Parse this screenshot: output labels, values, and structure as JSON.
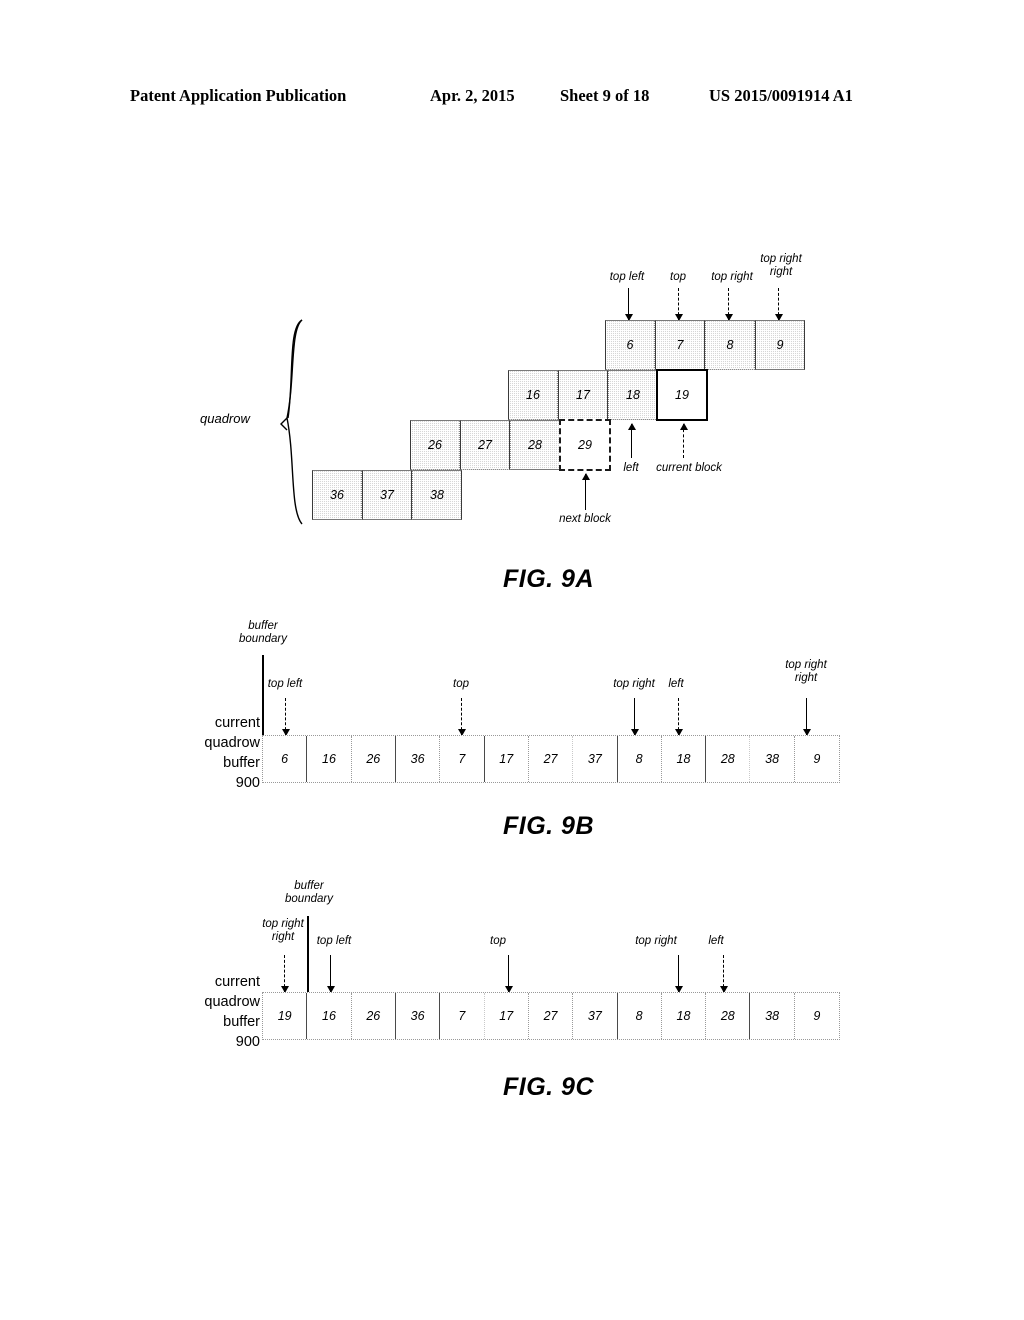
{
  "header": {
    "title": "Patent Application Publication",
    "date": "Apr. 2, 2015",
    "sheet": "Sheet 9 of 18",
    "patent_number": "US 2015/0091914 A1"
  },
  "figures": [
    {
      "id": "9A",
      "caption": "FIG. 9A",
      "group_label": "quadrow",
      "blocks": [
        {
          "id": "6",
          "state": "processed"
        },
        {
          "id": "7",
          "state": "processed"
        },
        {
          "id": "8",
          "state": "processed"
        },
        {
          "id": "9",
          "state": "processed"
        },
        {
          "id": "16",
          "state": "processed"
        },
        {
          "id": "17",
          "state": "processed"
        },
        {
          "id": "18",
          "state": "processed"
        },
        {
          "id": "19",
          "state": "current"
        },
        {
          "id": "26",
          "state": "processed"
        },
        {
          "id": "27",
          "state": "processed"
        },
        {
          "id": "28",
          "state": "processed"
        },
        {
          "id": "29",
          "state": "next"
        },
        {
          "id": "36",
          "state": "processed"
        },
        {
          "id": "37",
          "state": "processed"
        },
        {
          "id": "38",
          "state": "processed"
        }
      ],
      "annotations": [
        {
          "label": "top left",
          "target": "6",
          "direction": "down"
        },
        {
          "label": "top",
          "target": "7",
          "direction": "down"
        },
        {
          "label": "top right",
          "target": "8",
          "direction": "down"
        },
        {
          "label": "top right\nright",
          "target": "9",
          "direction": "down"
        },
        {
          "label": "left",
          "target": "18",
          "direction": "up"
        },
        {
          "label": "current block",
          "target": "19",
          "direction": "up"
        },
        {
          "label": "next block",
          "target": "29",
          "direction": "up"
        }
      ]
    },
    {
      "id": "9B",
      "caption": "FIG. 9B",
      "buffer_label": "current\nquadrow\nbuffer\n900",
      "buffer_label_lines": [
        "current",
        "quadrow",
        "buffer",
        "900"
      ],
      "cells": [
        "6",
        "16",
        "26",
        "36",
        "7",
        "17",
        "27",
        "37",
        "8",
        "18",
        "28",
        "38",
        "9"
      ],
      "boundary_label": "buffer\nboundary",
      "boundary_label_lines": [
        "buffer",
        "boundary"
      ],
      "boundary_before_cell_index": 0,
      "annotations": [
        {
          "label": "top left",
          "cell": "6",
          "cell_index": 0
        },
        {
          "label": "top",
          "cell": "7",
          "cell_index": 4
        },
        {
          "label": "top right",
          "cell": "8",
          "cell_index": 8
        },
        {
          "label": "left",
          "cell": "18",
          "cell_index": 9
        },
        {
          "label": "top right\nright",
          "cell": "9",
          "cell_index": 12
        }
      ]
    },
    {
      "id": "9C",
      "caption": "FIG. 9C",
      "buffer_label_lines": [
        "current",
        "quadrow",
        "buffer",
        "900"
      ],
      "cells": [
        "19",
        "16",
        "26",
        "36",
        "7",
        "17",
        "27",
        "37",
        "8",
        "18",
        "28",
        "38",
        "9"
      ],
      "boundary_label_lines": [
        "buffer",
        "boundary"
      ],
      "boundary_before_cell_index": 1,
      "annotations": [
        {
          "label": "top right\nright",
          "cell": "19",
          "cell_index": 0
        },
        {
          "label": "top left",
          "cell": "16",
          "cell_index": 1
        },
        {
          "label": "top",
          "cell": "17",
          "cell_index": 5
        },
        {
          "label": "top right",
          "cell": "18",
          "cell_index": 9
        },
        {
          "label": "left",
          "cell": "28",
          "cell_index": 10
        }
      ]
    }
  ],
  "labels": {
    "top_left": "top left",
    "top": "top",
    "top_right": "top right",
    "top_right_right_l1": "top right",
    "top_right_right_l2": "right",
    "left": "left",
    "current_block": "current block",
    "next_block": "next block",
    "quadrow": "quadrow",
    "buffer_l1": "buffer",
    "buffer_l2": "boundary",
    "cur_l1": "current",
    "cur_l2": "quadrow",
    "cur_l3": "buffer",
    "cur_l4": "900"
  }
}
